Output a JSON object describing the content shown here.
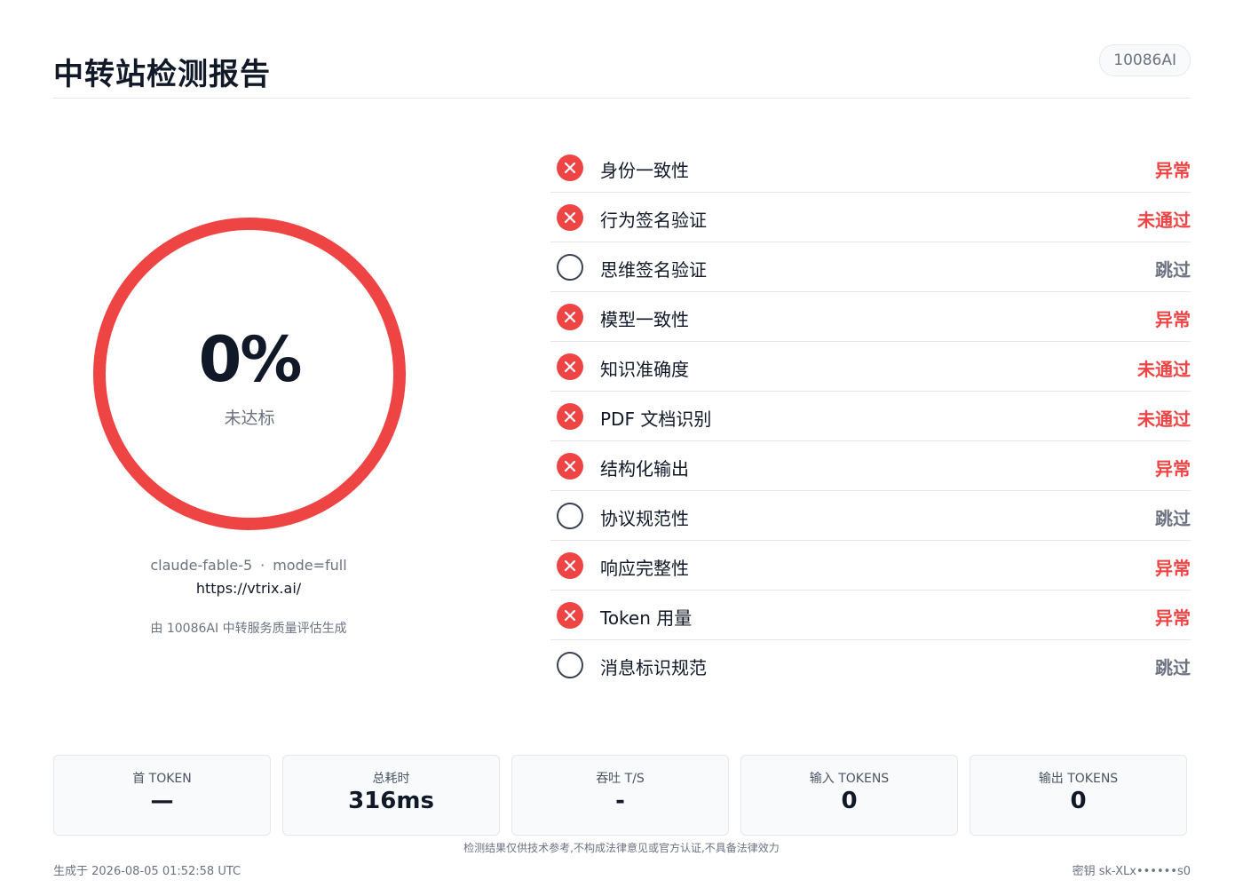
{
  "header": {
    "title": "中转站检测报告",
    "brand_badge": "10086AI"
  },
  "score": {
    "value": "0%",
    "status": "未达标",
    "progress_fraction": 0,
    "ring_color": "#ef4444",
    "model": "claude-fable-5",
    "separator": "·",
    "mode": "mode=full",
    "url": "https://vtrix.ai/",
    "generated_by": "由 10086AI 中转服务质量评估生成"
  },
  "checks": [
    {
      "label": "身份一致性",
      "status": "异常",
      "state": "fail",
      "icon": "x-circle-icon"
    },
    {
      "label": "行为签名验证",
      "status": "未通过",
      "state": "fail",
      "icon": "x-circle-icon"
    },
    {
      "label": "思维签名验证",
      "status": "跳过",
      "state": "skip",
      "icon": "empty-circle-icon"
    },
    {
      "label": "模型一致性",
      "status": "异常",
      "state": "fail",
      "icon": "x-circle-icon"
    },
    {
      "label": "知识准确度",
      "status": "未通过",
      "state": "fail",
      "icon": "x-circle-icon"
    },
    {
      "label": "PDF 文档识别",
      "status": "未通过",
      "state": "fail",
      "icon": "x-circle-icon"
    },
    {
      "label": "结构化输出",
      "status": "异常",
      "state": "fail",
      "icon": "x-circle-icon"
    },
    {
      "label": "协议规范性",
      "status": "跳过",
      "state": "skip",
      "icon": "empty-circle-icon"
    },
    {
      "label": "响应完整性",
      "status": "异常",
      "state": "fail",
      "icon": "x-circle-icon"
    },
    {
      "label": "Token 用量",
      "status": "异常",
      "state": "fail",
      "icon": "x-circle-icon"
    },
    {
      "label": "消息标识规范",
      "status": "跳过",
      "state": "skip",
      "icon": "empty-circle-icon"
    }
  ],
  "stats": [
    {
      "label": "首 TOKEN",
      "value": "—"
    },
    {
      "label": "总耗时",
      "value": "316ms"
    },
    {
      "label": "吞吐 T/S",
      "value": "-"
    },
    {
      "label": "输入 TOKENS",
      "value": "0"
    },
    {
      "label": "输出 TOKENS",
      "value": "0"
    }
  ],
  "footer": {
    "disclaimer": "检测结果仅供技术参考,不构成法律意见或官方认证,不具备法律效力",
    "generated_at": "生成于 2026-08-05 01:52:58 UTC",
    "key": "密钥 sk-XLx••••••s0"
  },
  "colors": {
    "fail": "#ef4444",
    "skip": "#6b7280",
    "text": "#111827"
  }
}
